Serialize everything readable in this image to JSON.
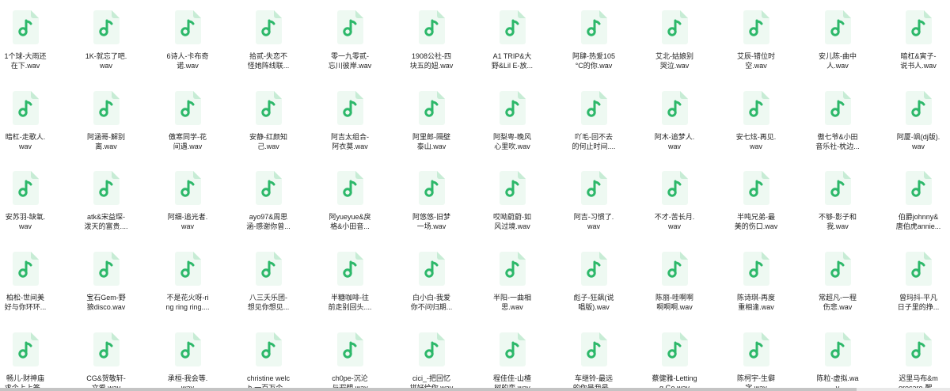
{
  "colors": {
    "icon_accent": "#2db86a",
    "icon_page": "#eef9f2",
    "icon_fold": "#c7ecd5"
  },
  "icons": {
    "file": "music-file-icon"
  },
  "files": [
    [
      "1个球-大雨还",
      "在下.wav"
    ],
    [
      "1K-就忘了吧.",
      "wav"
    ],
    [
      "6诗人-卡布奇",
      "诺.wav"
    ],
    [
      "拾贰-失恋不",
      "怪她阵线联..."
    ],
    [
      "零一九零贰-",
      "忘川彼岸.wav"
    ],
    [
      "1908公社-四",
      "块五的妞.wav"
    ],
    [
      "A1 TRIP&大",
      "野&Lil E-放..."
    ],
    [
      "阿肆-热爱105",
      "°C的你.wav"
    ],
    [
      "艾北-姑娘别",
      "哭泣.wav"
    ],
    [
      "艾辰-错位时",
      "空.wav"
    ],
    [
      "安儿陈-曲中",
      "人.wav"
    ],
    [
      "暗杠&寅子-",
      "说书人.wav"
    ],
    [
      "暗杠-走歌人.",
      "wav"
    ],
    [
      "阿涵哥-解别",
      "离.wav"
    ],
    [
      "傲寒同学-花",
      "间遇.wav"
    ],
    [
      "安静-红颜知",
      "己.wav"
    ],
    [
      "阿吉太组合-",
      "阿衣莫.wav"
    ],
    [
      "阿里郎-隔壁",
      "泰山.wav"
    ],
    [
      "阿梨粤-晚风",
      "心里吹.wav"
    ],
    [
      "吖毛-回不去",
      "的何止时间...."
    ],
    [
      "阿木-追梦人.",
      "wav"
    ],
    [
      "安七炫-再见.",
      "wav"
    ],
    [
      "傲七爷&小田",
      "音乐社-枕边..."
    ],
    [
      "阿厦-飒(dj版).",
      "wav"
    ],
    [
      "安苏羽-缺氧.",
      "wav"
    ],
    [
      "atk&宋益琛-",
      "泼天的富贵...."
    ],
    [
      "阿细-追光者.",
      "wav"
    ],
    [
      "ayo97&周思",
      "涵-感谢你曾..."
    ],
    [
      "阿yueyue&戾",
      "格&小田音..."
    ],
    [
      "阿悠悠-旧梦",
      "一场.wav"
    ],
    [
      "哎呦蔚蔚-如",
      "风过境.wav"
    ],
    [
      "阿吉-习惯了.",
      "wav"
    ],
    [
      "不才-苦长月.",
      "wav"
    ],
    [
      "半吨兄弟-最",
      "美的伤口.wav"
    ],
    [
      "不够-影子和",
      "我.wav"
    ],
    [
      "伯爵johnny&",
      "唐伯虎annie..."
    ],
    [
      "柏松-世间美",
      "好与你环环..."
    ],
    [
      "宝石Gem-野",
      "狼disco.wav"
    ],
    [
      "不是花火呀-ri",
      "ng ring ring...."
    ],
    [
      "八三夭乐团-",
      "想见你想见..."
    ],
    [
      "半糖咖啡-往",
      "前走别回头...."
    ],
    [
      "白小白-我爱",
      "你不问归期..."
    ],
    [
      "半阳-一曲相",
      "思.wav"
    ],
    [
      "彪子-狂飙(说",
      "唱版).wav"
    ],
    [
      "陈丽-哇啊啊",
      "啊啊啊.wav"
    ],
    [
      "陈诗琪-再度",
      "重相逢.wav"
    ],
    [
      "常超凡-一程",
      "伤悲.wav"
    ],
    [
      "曾玛抖-平凡",
      "日子里的挣..."
    ],
    [
      "畅儿-财神庙",
      "求个上上签..."
    ],
    [
      "CG&贺敬轩-",
      "文爱.wav"
    ],
    [
      "承桓-我会等.",
      "wav"
    ],
    [
      "christine welc",
      "h-一百万个..."
    ],
    [
      "ch0pe-沉沦",
      "与遐想.wav"
    ],
    [
      "cici_-把回忆",
      "拼好给你.wav"
    ],
    [
      "程佳佳-山楂",
      "树的恋.wav"
    ],
    [
      "车继铃-最远",
      "的你是我最..."
    ],
    [
      "蔡健雅-Letting",
      "g Go.wav"
    ],
    [
      "陈柯宇-生僻",
      "字.wav"
    ],
    [
      "陈粒-虚拟.wa",
      "v"
    ],
    [
      "迟里马布&m",
      "orecare-醒..."
    ]
  ]
}
